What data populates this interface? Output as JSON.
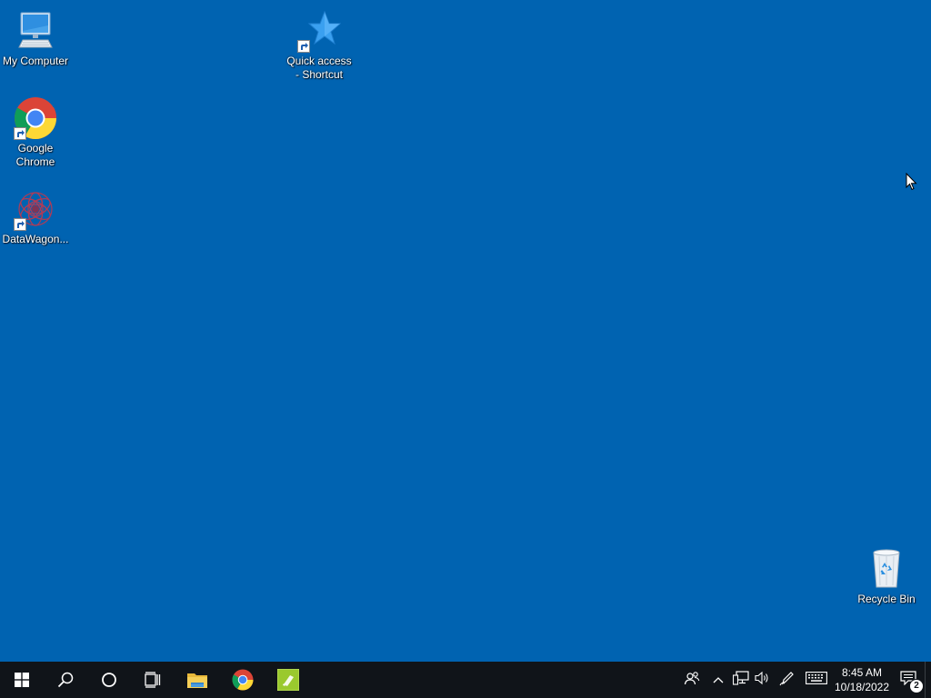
{
  "desktop": {
    "background": "#0063b1",
    "icons": [
      {
        "label": "My Computer",
        "icon": "computer-icon"
      },
      {
        "label": "Quick access - Shortcut",
        "icon": "star-icon"
      },
      {
        "label": "Google Chrome",
        "icon": "chrome-icon"
      },
      {
        "label": "DataWagon...",
        "icon": "datawagon-icon"
      },
      {
        "label": "Recycle Bin",
        "icon": "recycle-bin-icon"
      }
    ]
  },
  "taskbar": {
    "background": "#101419",
    "pinned": [
      {
        "name": "start",
        "icon": "windows-logo-icon"
      },
      {
        "name": "search",
        "icon": "search-icon"
      },
      {
        "name": "cortana",
        "icon": "cortana-circle-icon"
      },
      {
        "name": "task-view",
        "icon": "task-view-icon"
      },
      {
        "name": "file-explorer",
        "icon": "folder-icon"
      },
      {
        "name": "chrome",
        "icon": "chrome-icon"
      },
      {
        "name": "app",
        "icon": "green-app-icon"
      }
    ],
    "tray": {
      "icons": [
        "people-icon",
        "chevron-up-icon",
        "network-icon",
        "volume-icon",
        "pen-icon",
        "keyboard-icon"
      ],
      "time": "8:45 AM",
      "date": "10/18/2022",
      "notification_count": "2"
    }
  }
}
